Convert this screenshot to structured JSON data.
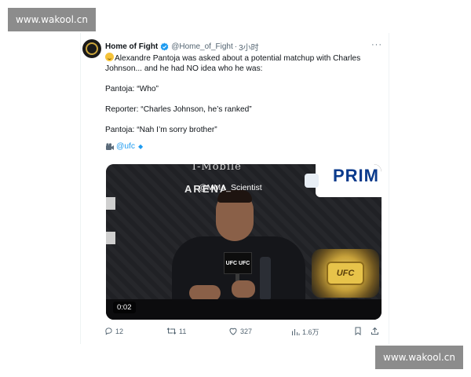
{
  "watermark": {
    "top_text": "www.wakool.cn",
    "bottom_text": "www.wakool.cn"
  },
  "tweet": {
    "author_name": "Home of Fight",
    "handle": "@Home_of_Fight",
    "separator": "·",
    "time": "3小时",
    "more_label": "···",
    "lines": {
      "intro_line1": "Alexandre Pantoja was asked about a potential matchup with Charles",
      "intro_line2": "Johnson... and he had NO idea who he was:",
      "quote1": "Pantoja: “Who”",
      "quote2": "Reporter: “Charles Johnson, he’s ranked”",
      "quote3": "Pantoja: “Nah I’m sorry brother”"
    },
    "mention": "@ufc",
    "mention_suffix": "◆",
    "icons": {
      "verified": "verified-badge-icon",
      "camera": "movie-camera-icon",
      "emoji": "sweat-smile-emoji-icon"
    }
  },
  "video": {
    "sponsor_top": "T-Mobile",
    "arena_text": "ARENA",
    "overlay_handle": "@MMA_Scientist",
    "prime_text": "PRIM",
    "mic_flag_text": "UFC UFC",
    "belt_text": "UFC",
    "timestamp": "0:02"
  },
  "actions": {
    "replies": "12",
    "retweets": "11",
    "likes": "327",
    "views": "1.6万"
  },
  "colors": {
    "accent": "#1d9bf0",
    "text_primary": "#0f1419",
    "text_secondary": "#536471",
    "watermark_bg": "#8c8c8c"
  }
}
